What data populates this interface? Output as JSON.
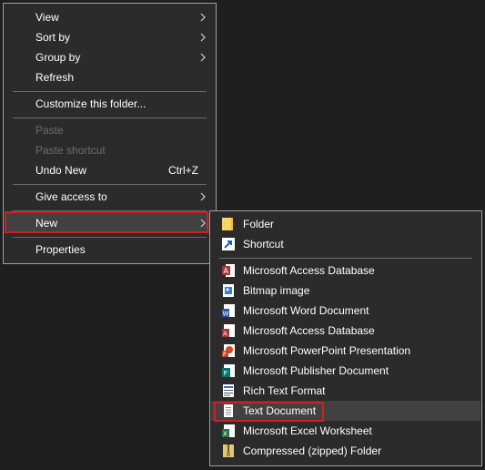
{
  "context_menu": {
    "items": [
      {
        "label": "View",
        "has_submenu": true
      },
      {
        "label": "Sort by",
        "has_submenu": true
      },
      {
        "label": "Group by",
        "has_submenu": true
      },
      {
        "label": "Refresh"
      },
      {
        "label": "Customize this folder..."
      },
      {
        "label": "Paste",
        "disabled": true
      },
      {
        "label": "Paste shortcut",
        "disabled": true
      },
      {
        "label": "Undo New",
        "shortcut": "Ctrl+Z"
      },
      {
        "label": "Give access to",
        "has_submenu": true
      },
      {
        "label": "New",
        "has_submenu": true,
        "highlighted": true
      },
      {
        "label": "Properties"
      }
    ]
  },
  "new_submenu": {
    "items": [
      {
        "label": "Folder",
        "icon": "folder-icon"
      },
      {
        "label": "Shortcut",
        "icon": "shortcut-icon"
      },
      {
        "label": "Microsoft Access Database",
        "icon": "access-icon"
      },
      {
        "label": "Bitmap image",
        "icon": "bitmap-icon"
      },
      {
        "label": "Microsoft Word Document",
        "icon": "word-icon"
      },
      {
        "label": "Microsoft Access Database",
        "icon": "access-icon"
      },
      {
        "label": "Microsoft PowerPoint Presentation",
        "icon": "powerpoint-icon"
      },
      {
        "label": "Microsoft Publisher Document",
        "icon": "publisher-icon"
      },
      {
        "label": "Rich Text Format",
        "icon": "wordpad-icon"
      },
      {
        "label": "Text Document",
        "icon": "text-document-icon",
        "highlighted": true
      },
      {
        "label": "Microsoft Excel Worksheet",
        "icon": "excel-icon"
      },
      {
        "label": "Compressed (zipped) Folder",
        "icon": "zip-folder-icon"
      }
    ]
  },
  "colors": {
    "menu_bg": "#2b2b2b",
    "highlight_outline": "#cc1f2a",
    "hover_bg": "#414141",
    "disabled_text": "#6d6d6d"
  }
}
